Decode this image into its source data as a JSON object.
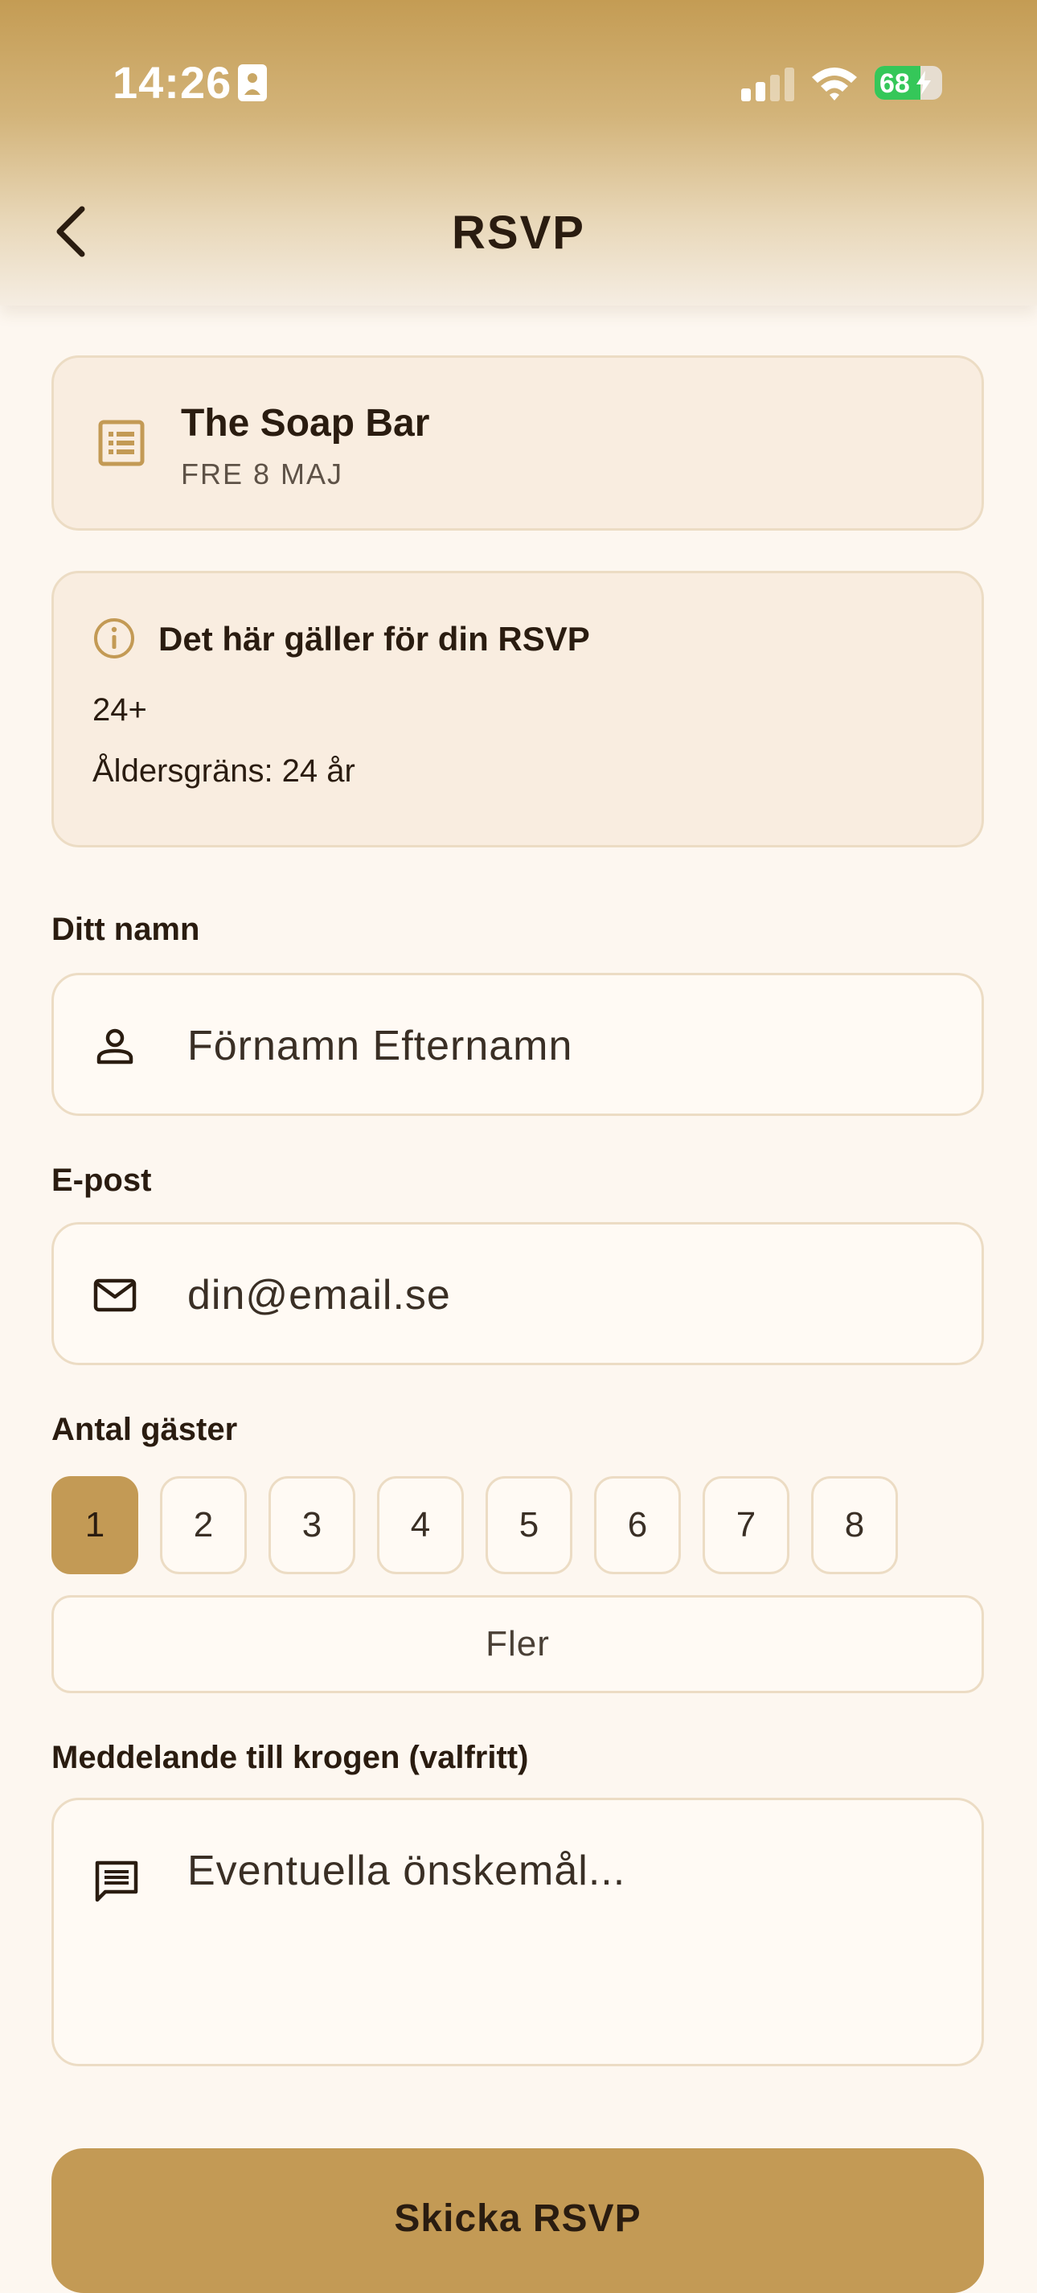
{
  "status_bar": {
    "time": "14:26",
    "battery_percent": "68",
    "battery_level": 0.68
  },
  "header": {
    "title": "RSVP"
  },
  "venue": {
    "name": "The Soap Bar",
    "date": "FRE 8 MAJ"
  },
  "rules": {
    "title": "Det här gäller för din RSVP",
    "line1": "24+",
    "line2": "Åldersgräns: 24 år"
  },
  "form": {
    "name_label": "Ditt namn",
    "name_placeholder": "Förnamn Efternamn",
    "email_label": "E-post",
    "email_placeholder": "din@email.se",
    "guests_label": "Antal gäster",
    "guest_options": [
      "1",
      "2",
      "3",
      "4",
      "5",
      "6",
      "7",
      "8"
    ],
    "selected_guests": "1",
    "more_label": "Fler",
    "message_label": "Meddelande till krogen (valfritt)",
    "message_placeholder": "Eventuella önskemål...",
    "submit_label": "Skicka RSVP"
  },
  "colors": {
    "accent": "#c39a55",
    "background": "#fdf7f0",
    "card": "#f9ede0",
    "border": "#ecdcc4",
    "text": "#2a1c10",
    "battery_green": "#35c759"
  },
  "icons": {
    "back": "chevron-left-icon",
    "venue": "list-icon",
    "info": "info-icon",
    "name": "person-icon",
    "email": "mail-icon",
    "message": "message-icon"
  }
}
